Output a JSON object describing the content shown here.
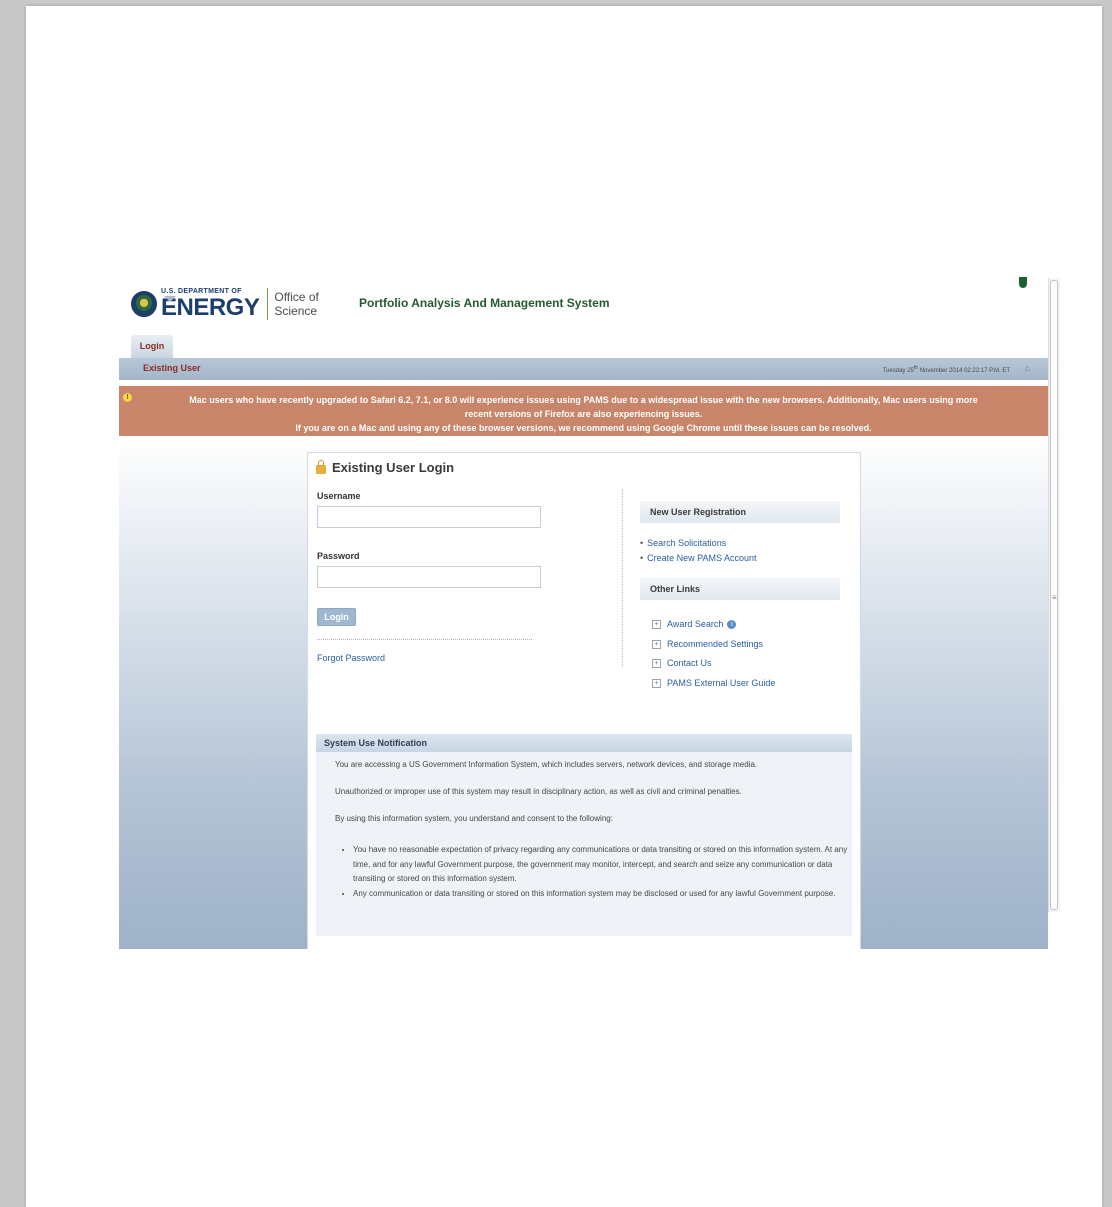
{
  "header": {
    "doe_line1": "U.S. DEPARTMENT OF",
    "doe_line2": "ENERGY",
    "office_line1": "Office of",
    "office_line2": "Science",
    "app_title": "Portfolio Analysis And Management System"
  },
  "nav": {
    "tab_login": "Login",
    "subtab_existing": "Existing User",
    "datetime_pre": "Tuesday 25",
    "datetime_sup": "th",
    "datetime_post": " November 2014 02:22:17 P.M. ET"
  },
  "warning": {
    "line1": "Mac users who have recently upgraded to Safari 6.2, 7.1, or 8.0 will experience issues using PAMS due to a widespread issue with the new browsers. Additionally, Mac users using more",
    "line2": "recent versions of Firefox are also experiencing issues.",
    "line3": "If you are on a Mac and using any of these browser versions, we recommend using Google Chrome until these issues can be resolved."
  },
  "login": {
    "title": "Existing User Login",
    "username_label": "Username",
    "username_value": "",
    "password_label": "Password",
    "password_value": "",
    "button": "Login",
    "forgot": "Forgot Password"
  },
  "sidebar": {
    "registration_title": "New User Registration",
    "registration_links": [
      "Search Solicitations",
      "Create New PAMS Account"
    ],
    "other_title": "Other Links",
    "other_links": [
      "Award Search",
      "Recommended Settings",
      "Contact Us",
      "PAMS External User Guide"
    ]
  },
  "notice": {
    "title": "System Use Notification",
    "p1": "You are accessing a US Government Information System, which includes servers, network devices, and storage media.",
    "p2": "Unauthorized or improper use of this system may result in disciplinary action, as well as civil and criminal penalties.",
    "p3": "By using this information system, you understand and consent to the following:",
    "bullets": [
      "You have no reasonable expectation of privacy regarding any communications or data transiting or stored on this information system. At any time, and for any lawful Government purpose, the government may monitor, intercept, and search and seize any communication or data transiting or stored on this information system.",
      "Any communication or data transiting or stored on this information system may be disclosed or used for any lawful Government purpose."
    ]
  },
  "colors": {
    "warning_bg": "#c8856a",
    "brand_green": "#245a2d",
    "link": "#2a5ea3",
    "tab_text": "#8b2d1f"
  }
}
